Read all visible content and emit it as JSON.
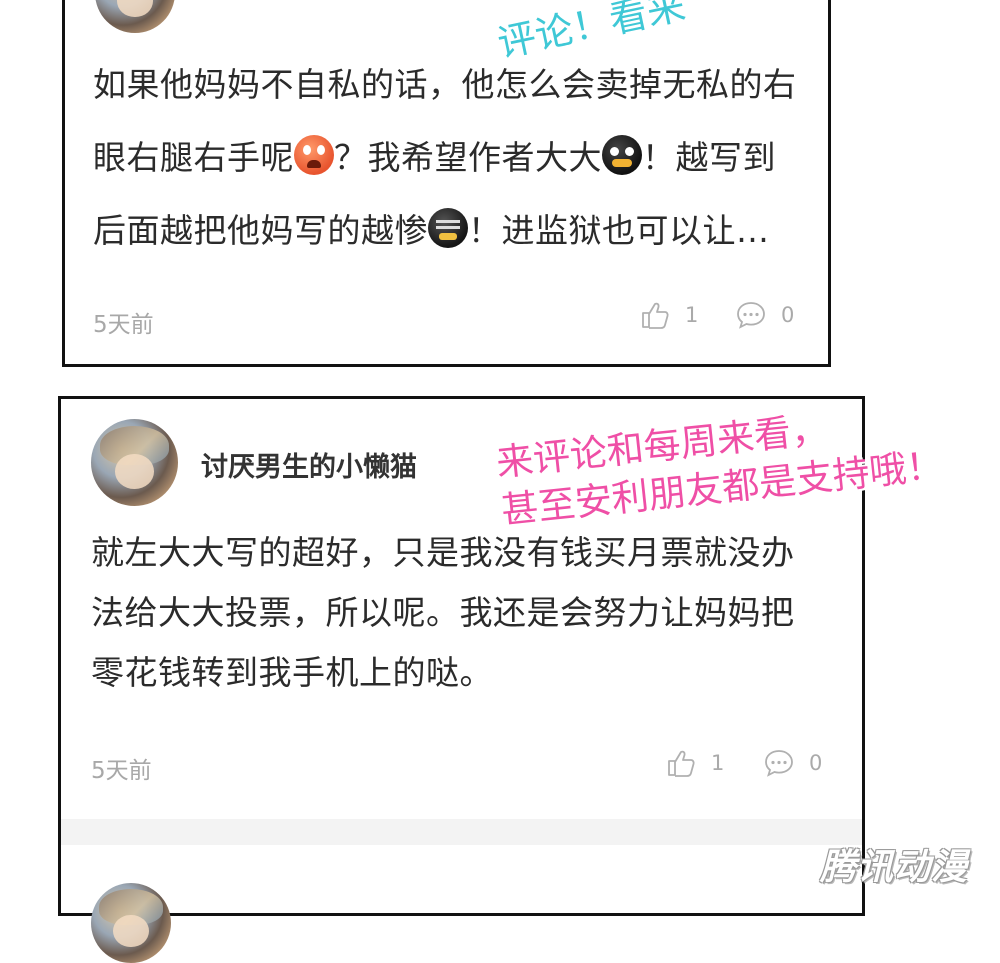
{
  "comments": [
    {
      "partial_header": "…",
      "text_lines": [
        "如果他妈妈不自私的话，他怎么会卖掉无私的右",
        [
          "眼右腿右手呢",
          "？我希望作者大大",
          "！越写到"
        ],
        [
          "后面越把他妈写的越惨",
          "！进监狱也可以让…"
        ]
      ],
      "emojis": [
        "shock-face-emoji",
        "dark-face-emoji",
        "crying-face-emoji"
      ],
      "time": "5天前",
      "likes": "1",
      "replies": "0"
    },
    {
      "username": "讨厌男生的小懒猫",
      "text_lines": [
        "就左大大写的超好，只是我没有钱买月票就没办",
        "法给大大投票，所以呢。我还是会努力让妈妈把",
        "零花钱转到我手机上的哒。"
      ],
      "time": "5天前",
      "likes": "1",
      "replies": "0"
    }
  ],
  "overlays": {
    "cyan_text": "评论！看来",
    "pink_line1": "来评论和每周来看，",
    "pink_line2": "甚至安利朋友都是支持哦！"
  },
  "watermark": "腾讯动漫",
  "colors": {
    "cyan": "#3fc8d6",
    "pink": "#ef4fa6",
    "meta": "#aaaaaa"
  }
}
